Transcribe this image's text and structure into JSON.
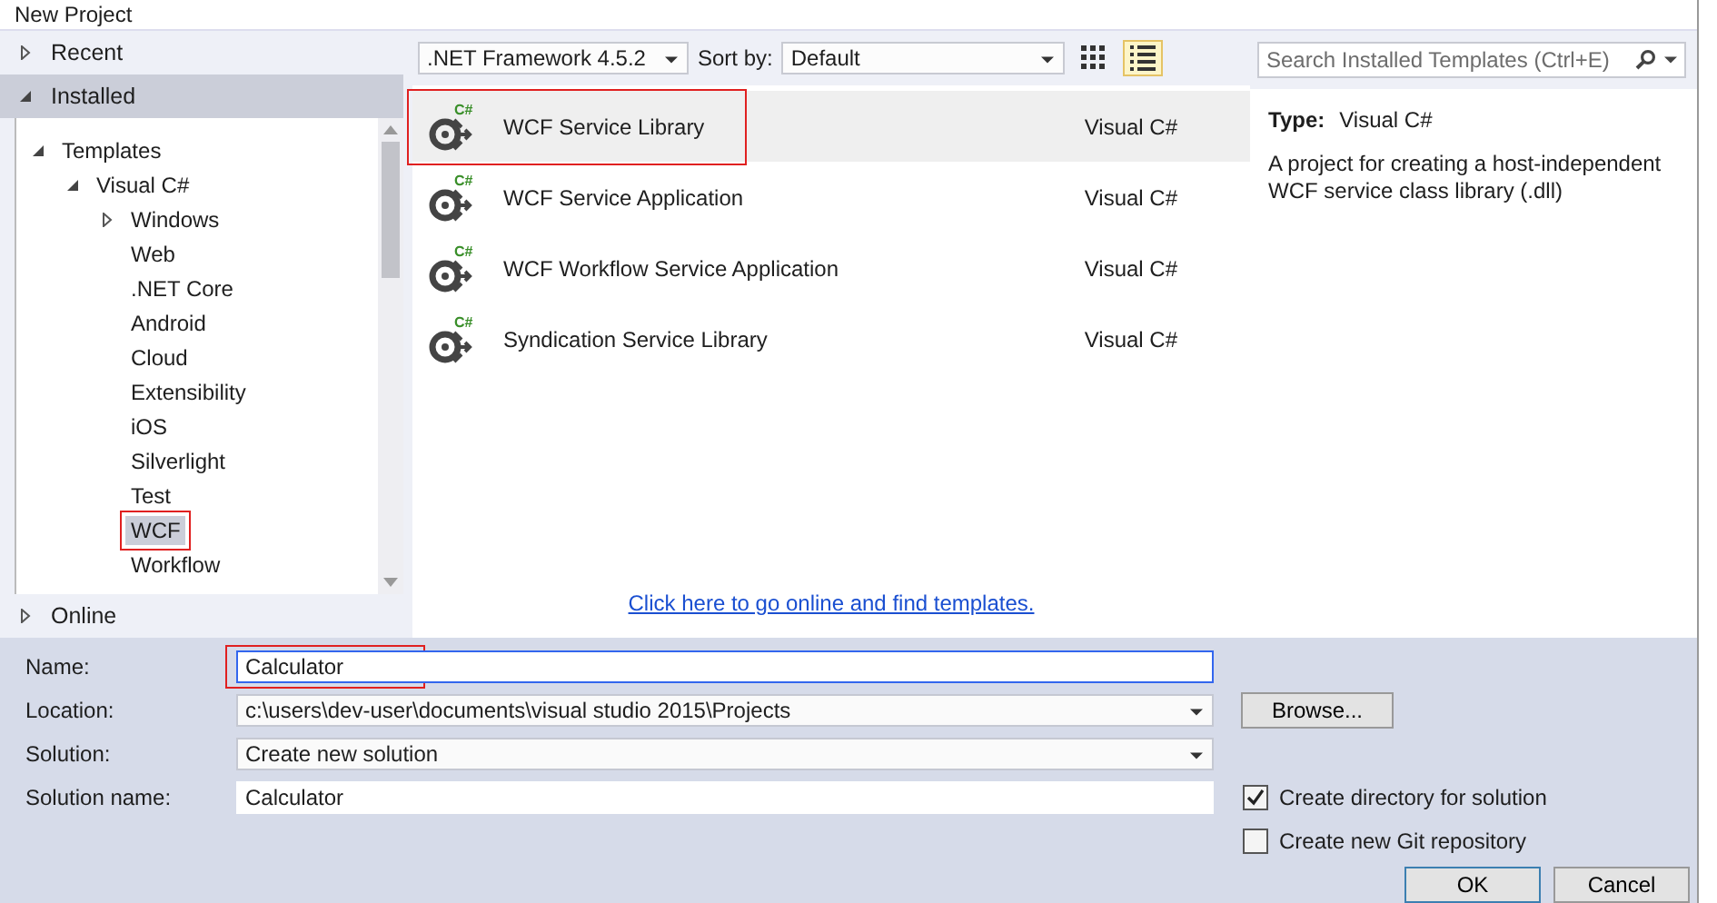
{
  "window": {
    "title": "New Project"
  },
  "sidebar": {
    "sections": [
      {
        "label": "Recent",
        "expanded": false,
        "selected": false
      },
      {
        "label": "Installed",
        "expanded": true,
        "selected": true,
        "children": [
          {
            "label": "Templates",
            "expanded": true,
            "selected": false,
            "children": [
              {
                "label": "Visual C#",
                "expanded": true,
                "selected": false,
                "children": [
                  {
                    "label": "Windows",
                    "expanded": false,
                    "selected": false
                  },
                  {
                    "label": "Web",
                    "selected": false
                  },
                  {
                    "label": ".NET Core",
                    "selected": false
                  },
                  {
                    "label": "Android",
                    "selected": false
                  },
                  {
                    "label": "Cloud",
                    "selected": false
                  },
                  {
                    "label": "Extensibility",
                    "selected": false
                  },
                  {
                    "label": "iOS",
                    "selected": false
                  },
                  {
                    "label": "Silverlight",
                    "selected": false
                  },
                  {
                    "label": "Test",
                    "selected": false
                  },
                  {
                    "label": "WCF",
                    "selected": true,
                    "annotated": true
                  },
                  {
                    "label": "Workflow",
                    "selected": false
                  }
                ]
              }
            ]
          }
        ]
      },
      {
        "label": "Online",
        "expanded": false,
        "selected": false
      }
    ]
  },
  "toolbar": {
    "framework": ".NET Framework 4.5.2",
    "sort_label": "Sort by:",
    "sort_value": "Default",
    "views": [
      {
        "kind": "grid",
        "selected": false
      },
      {
        "kind": "list",
        "selected": true
      }
    ]
  },
  "search": {
    "placeholder": "Search Installed Templates (Ctrl+E)"
  },
  "templates": [
    {
      "name": "WCF Service Library",
      "badge": "C#",
      "language": "Visual C#",
      "selected": true,
      "annotated": true
    },
    {
      "name": "WCF Service Application",
      "badge": "C#",
      "language": "Visual C#",
      "selected": false,
      "annotated": false
    },
    {
      "name": "WCF Workflow Service Application",
      "badge": "C#",
      "language": "Visual C#",
      "selected": false,
      "annotated": false
    },
    {
      "name": "Syndication Service Library",
      "badge": "C#",
      "language": "Visual C#",
      "selected": false,
      "annotated": false
    }
  ],
  "online_link": "Click here to go online and find templates.",
  "details": {
    "type_label": "Type:",
    "type_value": "Visual C#",
    "description": "A project for creating a host-independent WCF service class library (.dll)"
  },
  "form": {
    "fields": [
      {
        "label": "Name:",
        "value": "Calculator",
        "kind": "text",
        "focused": true,
        "annotated": true
      },
      {
        "label": "Location:",
        "value": "c:\\users\\dev-user\\documents\\visual studio 2015\\Projects",
        "kind": "dropdown",
        "focused": false,
        "annotated": false
      },
      {
        "label": "Solution:",
        "value": "Create new solution",
        "kind": "dropdown",
        "focused": false,
        "annotated": false
      },
      {
        "label": "Solution name:",
        "value": "Calculator",
        "kind": "text",
        "focused": false,
        "annotated": false
      }
    ],
    "browse_button": "Browse...",
    "checkboxes": [
      {
        "label": "Create directory for solution",
        "checked": true
      },
      {
        "label": "Create new Git repository",
        "checked": false
      }
    ],
    "buttons": [
      "OK",
      "Cancel"
    ]
  }
}
